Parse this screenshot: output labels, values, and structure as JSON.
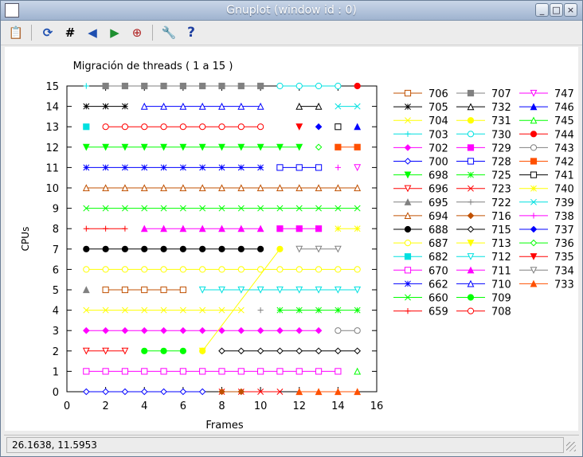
{
  "window": {
    "title": "Gnuplot (window id : 0)"
  },
  "window_controls": {
    "minimize": "_",
    "maximize": "□",
    "close": "×"
  },
  "toolbar": {
    "items": [
      {
        "name": "copy-clipboard-icon",
        "glyph": "📋"
      },
      {
        "name": "replot-icon",
        "glyph": "⟳"
      },
      {
        "name": "grid-icon",
        "glyph": "#"
      },
      {
        "name": "zoom-prev-icon",
        "glyph": "◀"
      },
      {
        "name": "zoom-next-icon",
        "glyph": "▶"
      },
      {
        "name": "autoscale-icon",
        "glyph": "⊕"
      },
      {
        "name": "options-wrench-icon",
        "glyph": "🔧"
      },
      {
        "name": "help-icon",
        "glyph": "?"
      }
    ]
  },
  "status": {
    "coords": "26.1638,  11.5953"
  },
  "chart_data": {
    "type": "scatter",
    "title": "Migración de threads ( 1 a 15 )",
    "xlabel": "Frames",
    "ylabel": "CPUs",
    "xlim": [
      0,
      16
    ],
    "ylim": [
      0,
      15
    ],
    "xticks": [
      0,
      2,
      4,
      6,
      8,
      10,
      12,
      14,
      16
    ],
    "yticks": [
      0,
      1,
      2,
      3,
      4,
      5,
      6,
      7,
      8,
      9,
      10,
      11,
      12,
      13,
      14,
      15
    ],
    "legend_position": "right",
    "series": [
      {
        "name": "706",
        "color": "#c05000",
        "marker": "sqo",
        "x": [
          2,
          3,
          4,
          5,
          6
        ],
        "y": [
          5,
          5,
          5,
          5,
          5
        ]
      },
      {
        "name": "705",
        "color": "#000000",
        "marker": "star",
        "x": [
          1,
          2,
          3
        ],
        "y": [
          14,
          14,
          14
        ]
      },
      {
        "name": "704",
        "color": "#ffff00",
        "marker": "x",
        "x": [
          1,
          2,
          3,
          4,
          5,
          6,
          7,
          8,
          9
        ],
        "y": [
          4,
          4,
          4,
          4,
          4,
          4,
          4,
          4,
          4
        ]
      },
      {
        "name": "703",
        "color": "#00e0e0",
        "marker": "plus",
        "x": [
          1
        ],
        "y": [
          15
        ]
      },
      {
        "name": "702",
        "color": "#ff00ff",
        "marker": "dia",
        "x": [
          1,
          2,
          3,
          4,
          5,
          6,
          7,
          8,
          9,
          10,
          11,
          12,
          13
        ],
        "y": [
          3,
          3,
          3,
          3,
          3,
          3,
          3,
          3,
          3,
          3,
          3,
          3,
          3
        ]
      },
      {
        "name": "700",
        "color": "#0000ff",
        "marker": "diao",
        "x": [
          1,
          2,
          3,
          4,
          5,
          6,
          7
        ],
        "y": [
          0,
          0,
          0,
          0,
          0,
          0,
          0
        ]
      },
      {
        "name": "698",
        "color": "#00ff00",
        "marker": "trid",
        "x": [
          1,
          2,
          3,
          4,
          5,
          6,
          7,
          8,
          9,
          10,
          11,
          12
        ],
        "y": [
          12,
          12,
          12,
          12,
          12,
          12,
          12,
          12,
          12,
          12,
          12,
          12
        ]
      },
      {
        "name": "696",
        "color": "#ff0000",
        "marker": "tridO",
        "x": [
          1,
          2,
          3
        ],
        "y": [
          2,
          2,
          2
        ]
      },
      {
        "name": "695",
        "color": "#808080",
        "marker": "tri",
        "x": [
          1
        ],
        "y": [
          5
        ]
      },
      {
        "name": "694",
        "color": "#c05000",
        "marker": "trio",
        "x": [
          1,
          2,
          3,
          4,
          5,
          6,
          7,
          8,
          9,
          10,
          11,
          12,
          13,
          14,
          15
        ],
        "y": [
          10,
          10,
          10,
          10,
          10,
          10,
          10,
          10,
          10,
          10,
          10,
          10,
          10,
          10,
          10
        ]
      },
      {
        "name": "688",
        "color": "#000000",
        "marker": "circ",
        "x": [
          1,
          2,
          3,
          4,
          5,
          6,
          7,
          8,
          9,
          10
        ],
        "y": [
          7,
          7,
          7,
          7,
          7,
          7,
          7,
          7,
          7,
          7
        ]
      },
      {
        "name": "687",
        "color": "#ffff00",
        "marker": "circo",
        "x": [
          1,
          2,
          3,
          4,
          5,
          6,
          7,
          8,
          9,
          10,
          11,
          12,
          13,
          14,
          15
        ],
        "y": [
          6,
          6,
          6,
          6,
          6,
          6,
          6,
          6,
          6,
          6,
          6,
          6,
          6,
          6,
          6
        ]
      },
      {
        "name": "682",
        "color": "#00e0e0",
        "marker": "sq",
        "x": [
          1
        ],
        "y": [
          13
        ]
      },
      {
        "name": "670",
        "color": "#ff00ff",
        "marker": "sqo",
        "x": [
          1,
          2,
          3,
          4,
          5,
          6,
          7,
          8,
          9,
          10,
          11,
          12,
          13,
          14
        ],
        "y": [
          1,
          1,
          1,
          1,
          1,
          1,
          1,
          1,
          1,
          1,
          1,
          1,
          1,
          1
        ]
      },
      {
        "name": "662",
        "color": "#0000ff",
        "marker": "star",
        "x": [
          1,
          2,
          3,
          4,
          5,
          6,
          7,
          8,
          9,
          10
        ],
        "y": [
          11,
          11,
          11,
          11,
          11,
          11,
          11,
          11,
          11,
          11
        ]
      },
      {
        "name": "660",
        "color": "#00ff00",
        "marker": "x",
        "x": [
          1,
          2,
          3,
          4,
          5,
          6,
          7,
          8,
          9,
          10,
          11,
          12,
          13,
          14,
          15
        ],
        "y": [
          9,
          9,
          9,
          9,
          9,
          9,
          9,
          9,
          9,
          9,
          9,
          9,
          9,
          9,
          9
        ]
      },
      {
        "name": "659",
        "color": "#ff0000",
        "marker": "plus",
        "x": [
          1,
          2,
          3
        ],
        "y": [
          8,
          8,
          8
        ]
      },
      {
        "name": "707",
        "color": "#808080",
        "marker": "sq",
        "x": [
          2,
          3,
          4,
          5,
          6,
          7,
          8,
          9,
          10
        ],
        "y": [
          15,
          15,
          15,
          15,
          15,
          15,
          15,
          15,
          15
        ]
      },
      {
        "name": "732",
        "color": "#000000",
        "marker": "trio",
        "x": [
          12,
          13
        ],
        "y": [
          14,
          14
        ]
      },
      {
        "name": "731",
        "color": "#ffff00",
        "marker": "circ",
        "x": [
          7,
          11
        ],
        "y": [
          2,
          7
        ]
      },
      {
        "name": "730",
        "color": "#00e0e0",
        "marker": "circo",
        "x": [
          11,
          12,
          13,
          14
        ],
        "y": [
          15,
          15,
          15,
          15
        ]
      },
      {
        "name": "729",
        "color": "#ff00ff",
        "marker": "sq",
        "x": [
          11,
          12,
          13
        ],
        "y": [
          8,
          8,
          8
        ]
      },
      {
        "name": "728",
        "color": "#0000ff",
        "marker": "sqo",
        "x": [
          11,
          12,
          13
        ],
        "y": [
          11,
          11,
          11
        ]
      },
      {
        "name": "725",
        "color": "#00ff00",
        "marker": "star",
        "x": [
          11,
          12,
          13,
          14,
          15
        ],
        "y": [
          4,
          4,
          4,
          4,
          4
        ]
      },
      {
        "name": "723",
        "color": "#ff0000",
        "marker": "x",
        "x": [
          8,
          9,
          10,
          11
        ],
        "y": [
          0,
          0,
          0,
          0
        ]
      },
      {
        "name": "722",
        "color": "#808080",
        "marker": "plus",
        "x": [
          10
        ],
        "y": [
          4
        ]
      },
      {
        "name": "716",
        "color": "#c05000",
        "marker": "dia",
        "x": [
          8,
          9
        ],
        "y": [
          0,
          0
        ]
      },
      {
        "name": "715",
        "color": "#000000",
        "marker": "diao",
        "x": [
          8,
          9,
          10,
          11,
          12,
          13,
          14,
          15
        ],
        "y": [
          2,
          2,
          2,
          2,
          2,
          2,
          2,
          2
        ]
      },
      {
        "name": "713",
        "color": "#ffff00",
        "marker": "trid",
        "x": [
          7
        ],
        "y": [
          2
        ]
      },
      {
        "name": "712",
        "color": "#00e0e0",
        "marker": "tridO",
        "x": [
          7,
          8,
          9,
          10,
          11,
          12,
          13,
          14,
          15
        ],
        "y": [
          5,
          5,
          5,
          5,
          5,
          5,
          5,
          5,
          5
        ]
      },
      {
        "name": "711",
        "color": "#ff00ff",
        "marker": "tri",
        "x": [
          4,
          5,
          6,
          7,
          8,
          9,
          10
        ],
        "y": [
          8,
          8,
          8,
          8,
          8,
          8,
          8
        ]
      },
      {
        "name": "710",
        "color": "#0000ff",
        "marker": "trio",
        "x": [
          4,
          5,
          6,
          7,
          8,
          9,
          10
        ],
        "y": [
          14,
          14,
          14,
          14,
          14,
          14,
          14
        ]
      },
      {
        "name": "709",
        "color": "#00ff00",
        "marker": "circ",
        "x": [
          4,
          5,
          6
        ],
        "y": [
          2,
          2,
          2
        ]
      },
      {
        "name": "708",
        "color": "#ff0000",
        "marker": "circo",
        "x": [
          2,
          3,
          4,
          5,
          6,
          7,
          8,
          9,
          10
        ],
        "y": [
          13,
          13,
          13,
          13,
          13,
          13,
          13,
          13,
          13
        ]
      },
      {
        "name": "747",
        "color": "#ff00ff",
        "marker": "tridO",
        "x": [
          15
        ],
        "y": [
          11
        ]
      },
      {
        "name": "746",
        "color": "#0000ff",
        "marker": "tri",
        "x": [
          15
        ],
        "y": [
          13
        ]
      },
      {
        "name": "745",
        "color": "#00ff00",
        "marker": "trio",
        "x": [
          15
        ],
        "y": [
          1
        ]
      },
      {
        "name": "744",
        "color": "#ff0000",
        "marker": "circ",
        "x": [
          15
        ],
        "y": [
          15
        ]
      },
      {
        "name": "743",
        "color": "#808080",
        "marker": "circo",
        "x": [
          14,
          15
        ],
        "y": [
          3,
          3
        ]
      },
      {
        "name": "742",
        "color": "#ff5000",
        "marker": "sq",
        "x": [
          14,
          15
        ],
        "y": [
          12,
          12
        ]
      },
      {
        "name": "741",
        "color": "#000000",
        "marker": "sqo",
        "x": [
          14
        ],
        "y": [
          13
        ]
      },
      {
        "name": "740",
        "color": "#ffff00",
        "marker": "star",
        "x": [
          14,
          15
        ],
        "y": [
          8,
          8
        ]
      },
      {
        "name": "739",
        "color": "#00e0e0",
        "marker": "x",
        "x": [
          14,
          15
        ],
        "y": [
          14,
          14
        ]
      },
      {
        "name": "738",
        "color": "#ff00ff",
        "marker": "plus",
        "x": [
          14
        ],
        "y": [
          11
        ]
      },
      {
        "name": "737",
        "color": "#0000ff",
        "marker": "dia",
        "x": [
          13
        ],
        "y": [
          13
        ]
      },
      {
        "name": "736",
        "color": "#00ff00",
        "marker": "diao",
        "x": [
          13
        ],
        "y": [
          12
        ]
      },
      {
        "name": "735",
        "color": "#ff0000",
        "marker": "trid",
        "x": [
          12
        ],
        "y": [
          13
        ]
      },
      {
        "name": "734",
        "color": "#808080",
        "marker": "tridO",
        "x": [
          12,
          13,
          14
        ],
        "y": [
          7,
          7,
          7
        ]
      },
      {
        "name": "733",
        "color": "#ff5000",
        "marker": "tri",
        "x": [
          12,
          13,
          14,
          15
        ],
        "y": [
          0,
          0,
          0,
          0
        ]
      }
    ]
  }
}
